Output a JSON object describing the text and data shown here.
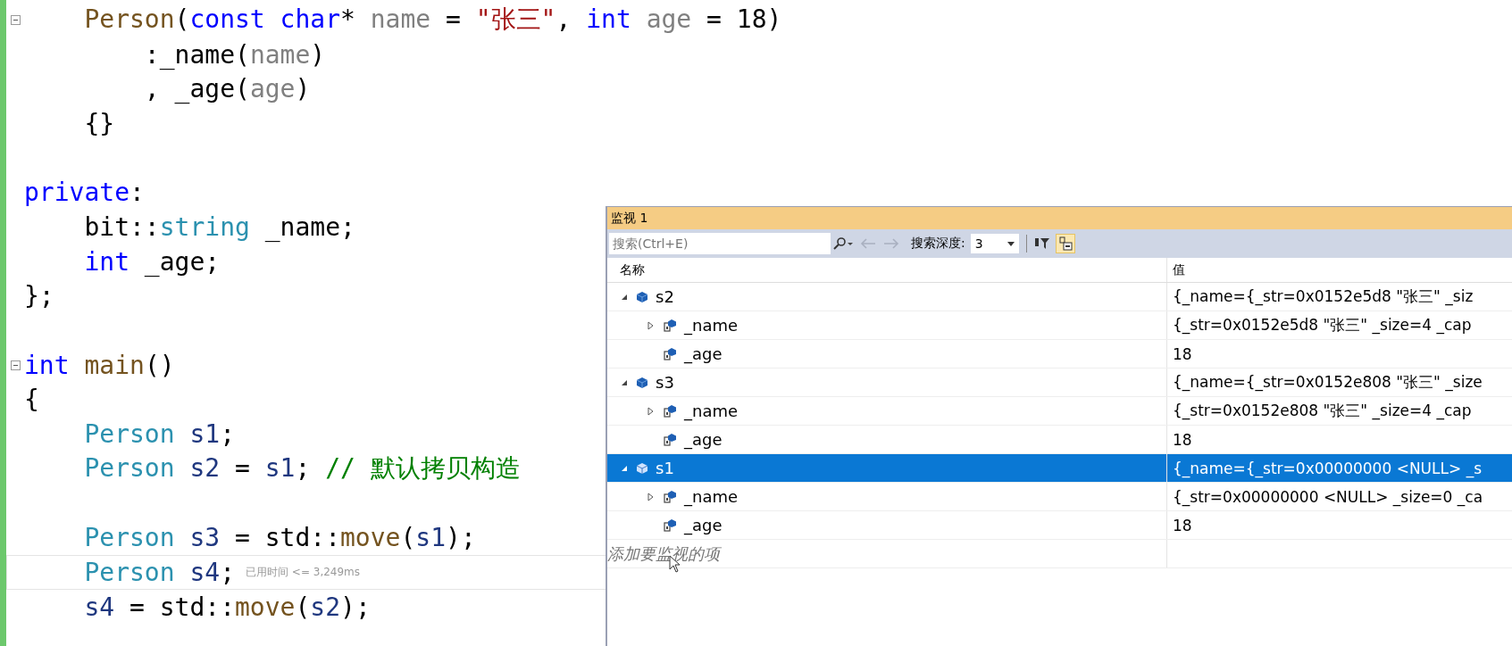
{
  "editor": {
    "lines": [
      {
        "kind": "fold_start",
        "tokens": [
          {
            "text": "    Person",
            "kind": "func"
          },
          {
            "text": "(",
            "kind": "plain"
          },
          {
            "text": "const",
            "kind": "keyword"
          },
          {
            "text": " char",
            "kind": "keyword"
          },
          {
            "text": "* ",
            "kind": "plain"
          },
          {
            "text": "name",
            "kind": "param"
          },
          {
            "text": " = ",
            "kind": "plain"
          },
          {
            "text": "\"张三\"",
            "kind": "string"
          },
          {
            "text": ", ",
            "kind": "plain"
          },
          {
            "text": "int",
            "kind": "keyword"
          },
          {
            "text": " age",
            "kind": "param"
          },
          {
            "text": " = 18)",
            "kind": "plain"
          }
        ]
      },
      {
        "kind": "code",
        "tokens": [
          {
            "text": "        :_name(",
            "kind": "plain"
          },
          {
            "text": "name",
            "kind": "param"
          },
          {
            "text": ")",
            "kind": "plain"
          }
        ]
      },
      {
        "kind": "code",
        "tokens": [
          {
            "text": "        , _age(",
            "kind": "plain"
          },
          {
            "text": "age",
            "kind": "param"
          },
          {
            "text": ")",
            "kind": "plain"
          }
        ]
      },
      {
        "kind": "code",
        "tokens": [
          {
            "text": "    {}",
            "kind": "plain"
          }
        ]
      },
      {
        "kind": "blank"
      },
      {
        "kind": "code",
        "tokens": [
          {
            "text": "private",
            "kind": "keyword"
          },
          {
            "text": ":",
            "kind": "plain"
          }
        ]
      },
      {
        "kind": "code",
        "tokens": [
          {
            "text": "    bit::",
            "kind": "plain"
          },
          {
            "text": "string",
            "kind": "type"
          },
          {
            "text": " _name;",
            "kind": "plain"
          }
        ]
      },
      {
        "kind": "code",
        "tokens": [
          {
            "text": "    int",
            "kind": "keyword"
          },
          {
            "text": " _age;",
            "kind": "plain"
          }
        ]
      },
      {
        "kind": "code",
        "tokens": [
          {
            "text": "};",
            "kind": "plain"
          }
        ]
      },
      {
        "kind": "blank"
      },
      {
        "kind": "fold_start",
        "tokens": [
          {
            "text": "int",
            "kind": "keyword"
          },
          {
            "text": " main",
            "kind": "func"
          },
          {
            "text": "()",
            "kind": "plain"
          }
        ]
      },
      {
        "kind": "code",
        "tokens": [
          {
            "text": "{",
            "kind": "plain"
          }
        ]
      },
      {
        "kind": "code",
        "tokens": [
          {
            "text": "    Person",
            "kind": "type"
          },
          {
            "text": " s1",
            "kind": "var"
          },
          {
            "text": ";",
            "kind": "plain"
          }
        ]
      },
      {
        "kind": "code",
        "tokens": [
          {
            "text": "    Person",
            "kind": "type"
          },
          {
            "text": " s2",
            "kind": "var"
          },
          {
            "text": " = ",
            "kind": "plain"
          },
          {
            "text": "s1",
            "kind": "var"
          },
          {
            "text": "; ",
            "kind": "plain"
          },
          {
            "text": "// 默认拷贝构造",
            "kind": "comment"
          }
        ]
      },
      {
        "kind": "blank"
      },
      {
        "kind": "code",
        "tokens": [
          {
            "text": "    Person",
            "kind": "type"
          },
          {
            "text": " s3",
            "kind": "var"
          },
          {
            "text": " = std::",
            "kind": "plain"
          },
          {
            "text": "move",
            "kind": "func"
          },
          {
            "text": "(",
            "kind": "plain"
          },
          {
            "text": "s1",
            "kind": "var"
          },
          {
            "text": ");",
            "kind": "plain"
          }
        ]
      },
      {
        "kind": "current",
        "hint": "已用时间 <= 3,249ms",
        "tokens": [
          {
            "text": "    Person",
            "kind": "type"
          },
          {
            "text": " s4",
            "kind": "var"
          },
          {
            "text": ";",
            "kind": "plain"
          }
        ]
      },
      {
        "kind": "code",
        "tokens": [
          {
            "text": "    s4",
            "kind": "var"
          },
          {
            "text": " = std::",
            "kind": "plain"
          },
          {
            "text": "move",
            "kind": "func"
          },
          {
            "text": "(",
            "kind": "plain"
          },
          {
            "text": "s2",
            "kind": "var"
          },
          {
            "text": ");",
            "kind": "plain"
          }
        ]
      }
    ]
  },
  "watch": {
    "title": "监视 1",
    "search": {
      "placeholder": "搜索(Ctrl+E)"
    },
    "depth_label": "搜索深度:",
    "depth": "3",
    "columns": [
      "名称",
      "值"
    ],
    "rows": [
      {
        "name": "s2",
        "kind": "object",
        "expanded": true,
        "selected": false,
        "value": "{_name={_str=0x0152e5d8 \"张三\" _siz",
        "children": [
          {
            "name": "_name",
            "kind": "field",
            "expanded": false,
            "selected": false,
            "value": "{_str=0x0152e5d8 \"张三\" _size=4 _cap"
          },
          {
            "name": "_age",
            "kind": "field",
            "selected": false,
            "value": "18"
          }
        ]
      },
      {
        "name": "s3",
        "kind": "object",
        "expanded": true,
        "selected": false,
        "value": "{_name={_str=0x0152e808 \"张三\" _size",
        "children": [
          {
            "name": "_name",
            "kind": "field",
            "expanded": false,
            "selected": false,
            "value": "{_str=0x0152e808 \"张三\" _size=4 _cap"
          },
          {
            "name": "_age",
            "kind": "field",
            "selected": false,
            "value": "18"
          }
        ]
      },
      {
        "name": "s1",
        "kind": "object",
        "expanded": true,
        "selected": true,
        "value": "{_name={_str=0x00000000 <NULL> _s",
        "children": [
          {
            "name": "_name",
            "kind": "field",
            "expanded": false,
            "selected": false,
            "value": "{_str=0x00000000 <NULL> _size=0 _ca"
          },
          {
            "name": "_age",
            "kind": "field",
            "selected": false,
            "value": "18"
          }
        ]
      }
    ],
    "add_placeholder": "添加要监视的项"
  }
}
